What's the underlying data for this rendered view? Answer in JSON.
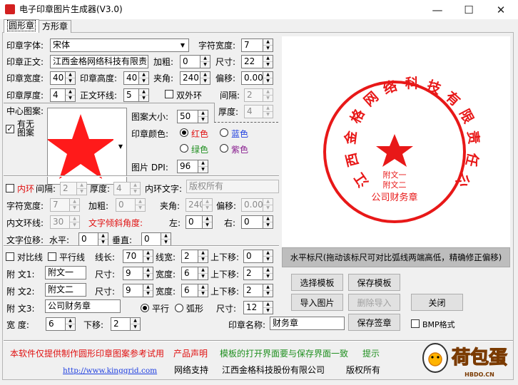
{
  "window": {
    "title": "电子印章图片生成器(V3.0)",
    "controls": {
      "minimize": "—",
      "maximize": "☐",
      "close": "✕"
    }
  },
  "tabs": [
    {
      "label": "圆形章",
      "active": true
    },
    {
      "label": "方形章",
      "active": false
    }
  ],
  "row1": {
    "font_label": "印章字体:",
    "font_value": "宋体",
    "char_width_label": "字符宽度:",
    "char_width_value": "7"
  },
  "row2": {
    "text_label": "印章正文:",
    "text_value": "江西金格网络科技有限责",
    "bold_label": "加粗:",
    "bold_value": "0",
    "size_label": "尺寸:",
    "size_value": "22"
  },
  "row3": {
    "width_label": "印章宽度:",
    "width_value": "40",
    "height_label": "印章高度:",
    "height_value": "40",
    "angle_label": "夹角:",
    "angle_value": "240",
    "offset_label": "偏移:",
    "offset_value": "0.000"
  },
  "row4": {
    "thick_label": "印章厚度:",
    "thick_value": "4",
    "ring_label": "正文环线:",
    "ring_value": "5",
    "double_ring_label": "双外环",
    "gap_label": "间隔:",
    "gap_value": "2",
    "thick2_label": "厚度:",
    "thick2_value": "4"
  },
  "center": {
    "label": "中心图案:",
    "has_none_label": "有无图案",
    "has_none_checked": true,
    "pattern_size_label": "图案大小:",
    "pattern_size_value": "50",
    "color_label": "印章颜色:",
    "colors": [
      "红色",
      "蓝色",
      "绿色",
      "紫色"
    ],
    "selected_color": "红色",
    "dpi_label": "图片 DPI:",
    "dpi_value": "96"
  },
  "inner": {
    "ring_label": "内环",
    "gap_label": "间隔:",
    "gap_value": "2",
    "thick_label": "厚度:",
    "thick_value": "4",
    "text_label": "内环文字:",
    "text_value": "版权所有",
    "charw_label": "字符宽度:",
    "charw_value": "7",
    "bold_label": "加粗:",
    "bold_value": "0",
    "angle_label": "夹角:",
    "angle_value": "240",
    "offset_label": "偏移:",
    "offset_value": "0.000",
    "inner_ring_label": "内文环线:",
    "inner_ring_value": "30",
    "tilt_label": "文字倾斜角度:",
    "left_label": "左:",
    "left_value": "0",
    "right_label": "右:",
    "right_value": "0",
    "shift_label": "文字位移:",
    "h_label": "水平:",
    "h_value": "0",
    "v_label": "垂直:",
    "v_value": "0"
  },
  "lines": {
    "contrast_label": "对比线",
    "parallel_label": "平行线",
    "length_label": "线长:",
    "length_value": "70",
    "width_label": "线宽:",
    "width_value": "2",
    "move_label": "上下移:",
    "move_value": "0"
  },
  "subtexts": [
    {
      "label": "附  文1:",
      "value": "附文一",
      "size_label": "尺寸:",
      "size": "9",
      "width_label": "宽度:",
      "width": "6",
      "move_label": "上下移:",
      "move": "2"
    },
    {
      "label": "附  文2:",
      "value": "附文二",
      "size_label": "尺寸:",
      "size": "9",
      "width_label": "宽度:",
      "width": "6",
      "move_label": "上下移:",
      "move": "2"
    }
  ],
  "subtext3": {
    "label": "附  文3:",
    "value": "公司财务章",
    "parallel_label": "平行",
    "arc_label": "弧形",
    "size_label": "尺寸:",
    "size": "12"
  },
  "bottom": {
    "width_label": "宽    度:",
    "width_value": "6",
    "down_label": "下移:",
    "down_value": "2",
    "seal_name_label": "印章名称:",
    "seal_name_value": "财务章",
    "bmp_label": "BMP格式"
  },
  "preview": {
    "seal_text": "江西金格网络科技有限责任公司",
    "inner_lines": [
      "附文一",
      "附文二"
    ],
    "bottom_text": "公司财务章",
    "color": "#e81818"
  },
  "ruler": {
    "text": "水平标尺(拖动该标尺可对比弧线两端高低，精确修正偏移)"
  },
  "buttons": {
    "choose_template": "选择模板",
    "save_template": "保存模板",
    "import_image": "导入图片",
    "delete_import": "删除导入",
    "close": "关闭",
    "save_sign": "保存签章"
  },
  "footer": {
    "notice": "本软件仅提供制作圆形印章图案参考试用",
    "product_statement": "产品声明",
    "template_notice": "模板的打开界面要与保存界面一致",
    "hint": "提示",
    "url": "http://www.kinggrid.com",
    "net_support": "网络支持",
    "company": "江西金格科技股份有限公司",
    "rights": "版权所有"
  },
  "watermark": {
    "logo_text": "荷包蛋",
    "logo_sub": "HBDO.CN"
  }
}
